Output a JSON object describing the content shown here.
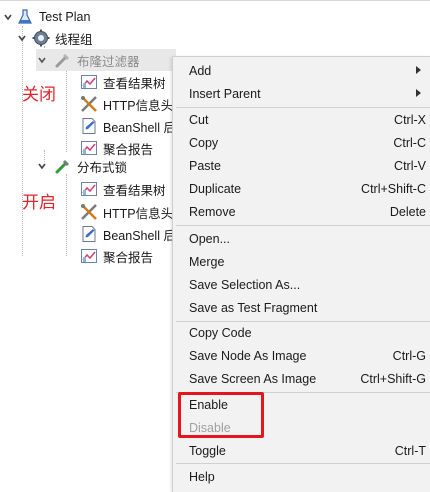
{
  "tree": {
    "root": {
      "label": "Test Plan",
      "icon": "beaker-icon"
    },
    "thread_group": {
      "label": "线程组",
      "icon": "gear-icon"
    },
    "nodes": [
      {
        "label": "布隆过滤器",
        "icon": "pipette-icon",
        "state": "disabled"
      },
      {
        "label": "查看结果树",
        "icon": "chart-icon"
      },
      {
        "label": "HTTP信息头",
        "icon": "wrench-scissors-icon"
      },
      {
        "label": "BeanShell 后",
        "icon": "script-icon"
      },
      {
        "label": "聚合报告",
        "icon": "chart-icon"
      },
      {
        "label": "分布式锁",
        "icon": "pipette-icon",
        "state": "enabled"
      },
      {
        "label": "查看结果树",
        "icon": "chart-icon"
      },
      {
        "label": "HTTP信息头",
        "icon": "wrench-scissors-icon"
      },
      {
        "label": "BeanShell 后",
        "icon": "script-icon"
      },
      {
        "label": "聚合报告",
        "icon": "chart-icon"
      }
    ]
  },
  "annotations": {
    "closed": "关闭",
    "opened": "开启",
    "color": "#e0262b"
  },
  "context_menu": {
    "items": [
      {
        "label": "Add",
        "submenu": true
      },
      {
        "label": "Insert Parent",
        "submenu": true
      },
      {
        "label": "Cut",
        "shortcut": "Ctrl-X"
      },
      {
        "label": "Copy",
        "shortcut": "Ctrl-C"
      },
      {
        "label": "Paste",
        "shortcut": "Ctrl-V"
      },
      {
        "label": "Duplicate",
        "shortcut": "Ctrl+Shift-C"
      },
      {
        "label": "Remove",
        "shortcut": "Delete"
      },
      {
        "label": "Open..."
      },
      {
        "label": "Merge"
      },
      {
        "label": "Save Selection As..."
      },
      {
        "label": "Save as Test Fragment"
      },
      {
        "label": "Copy Code"
      },
      {
        "label": "Save Node As Image",
        "shortcut": "Ctrl-G"
      },
      {
        "label": "Save Screen As Image",
        "shortcut": "Ctrl+Shift-G"
      },
      {
        "label": "Enable",
        "highlighted": true
      },
      {
        "label": "Disable",
        "disabled": true,
        "highlighted": true
      },
      {
        "label": "Toggle",
        "shortcut": "Ctrl-T"
      },
      {
        "label": "Help"
      }
    ],
    "highlight_color": "#e5151e"
  }
}
